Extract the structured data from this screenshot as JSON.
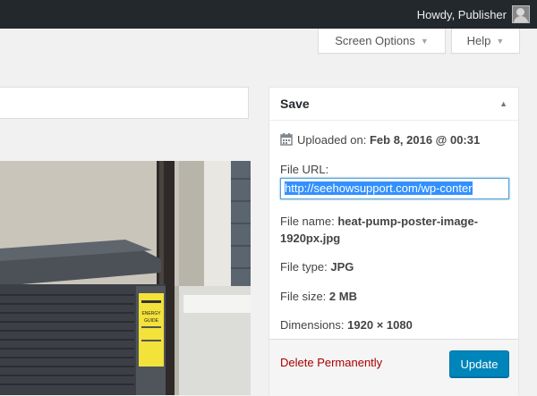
{
  "adminbar": {
    "greeting": "Howdy, Publisher"
  },
  "screen_meta": {
    "screen_options_label": "Screen Options",
    "help_label": "Help"
  },
  "save_box": {
    "title": "Save",
    "uploaded_label": "Uploaded on:",
    "uploaded_value": "Feb 8, 2016 @ 00:31",
    "file_url_label": "File URL:",
    "file_url_value": "http://seehowsupport.com/wp-conter",
    "file_name_label": "File name:",
    "file_name_line1": "heat-pump-poster-image-",
    "file_name_line2": "1920px.jpg",
    "file_type_label": "File type:",
    "file_type_value": "JPG",
    "file_size_label": "File size:",
    "file_size_value": "2 MB",
    "dimensions_label": "Dimensions:",
    "dimensions_value": "1920 × 1080",
    "delete_label": "Delete Permanently",
    "update_label": "Update"
  },
  "image_sticker_lines": [
    "ENERGY",
    "GUIDE"
  ],
  "colors": {
    "adminbar": "#23282d",
    "primary_button": "#0085ba",
    "delete_link": "#aa0000",
    "selection": "#3390ff"
  }
}
